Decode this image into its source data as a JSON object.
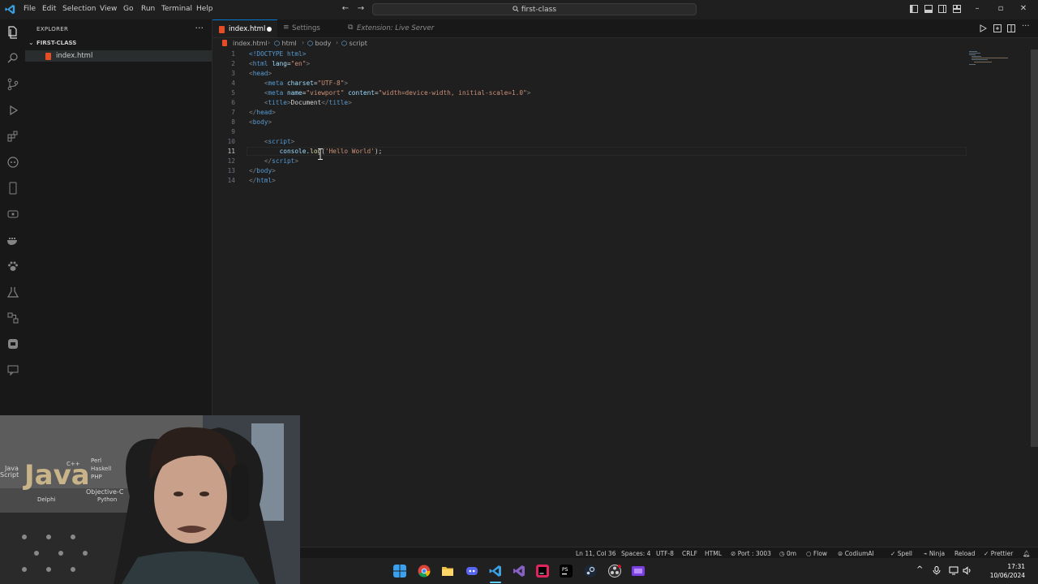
{
  "window": {
    "menu": [
      "File",
      "Edit",
      "Selection",
      "View",
      "Go",
      "Run",
      "Terminal",
      "Help"
    ],
    "search_text": "first-class"
  },
  "sidebar": {
    "title": "EXPLORER",
    "folder": "FIRST-CLASS",
    "files": [
      "index.html"
    ]
  },
  "tabs": [
    {
      "label": "index.html"
    },
    {
      "label": "Settings"
    },
    {
      "label": "Extension: Live Server"
    }
  ],
  "breadcrumb": [
    "index.html",
    "html",
    "body",
    "script"
  ],
  "editor": {
    "active_line": 11,
    "lines": [
      {
        "n": "1"
      },
      {
        "n": "2"
      },
      {
        "n": "3"
      },
      {
        "n": "4"
      },
      {
        "n": "5"
      },
      {
        "n": "6"
      },
      {
        "n": "7"
      },
      {
        "n": "8"
      },
      {
        "n": "9"
      },
      {
        "n": "10"
      },
      {
        "n": "11"
      },
      {
        "n": "12"
      },
      {
        "n": "13"
      },
      {
        "n": "14"
      }
    ],
    "code": {
      "l1": "<!DOCTYPE html>",
      "l2_tag": "html",
      "l2_attr": "lang",
      "l2_val": "\"en\"",
      "l3": "head",
      "l4_tag": "meta",
      "l4_attr": "charset",
      "l4_val": "\"UTF-8\"",
      "l5_tag": "meta",
      "l5_attr1": "name",
      "l5_val1": "\"viewport\"",
      "l5_attr2": "content",
      "l5_val2": "\"width=device-width, initial-scale=1.0\"",
      "l6_tag": "title",
      "l6_text": "Document",
      "l7": "head",
      "l8": "body",
      "l10": "script",
      "l11_obj": "console.",
      "l11_fn": "log",
      "l11_str": "'Hello World'",
      "l12": "script",
      "l13": "body",
      "l14": "html"
    }
  },
  "status": {
    "position": "Ln 11, Col 36",
    "spaces": "Spaces: 4",
    "encoding": "UTF-8",
    "eol": "CRLF",
    "language": "HTML",
    "port": "Port : 3003",
    "time": "0m",
    "flow": "Flow",
    "codium": "CodiumAI",
    "spell": "Spell",
    "ninja": "Ninja",
    "reload": "Reload",
    "prettier": "Prettier"
  },
  "taskbar": {
    "time": "17:31",
    "date": "10/06/2024"
  },
  "colors": {
    "accent": "#0078d4",
    "editor_bg": "#1f1f1f",
    "html_icon": "#e44d26"
  }
}
